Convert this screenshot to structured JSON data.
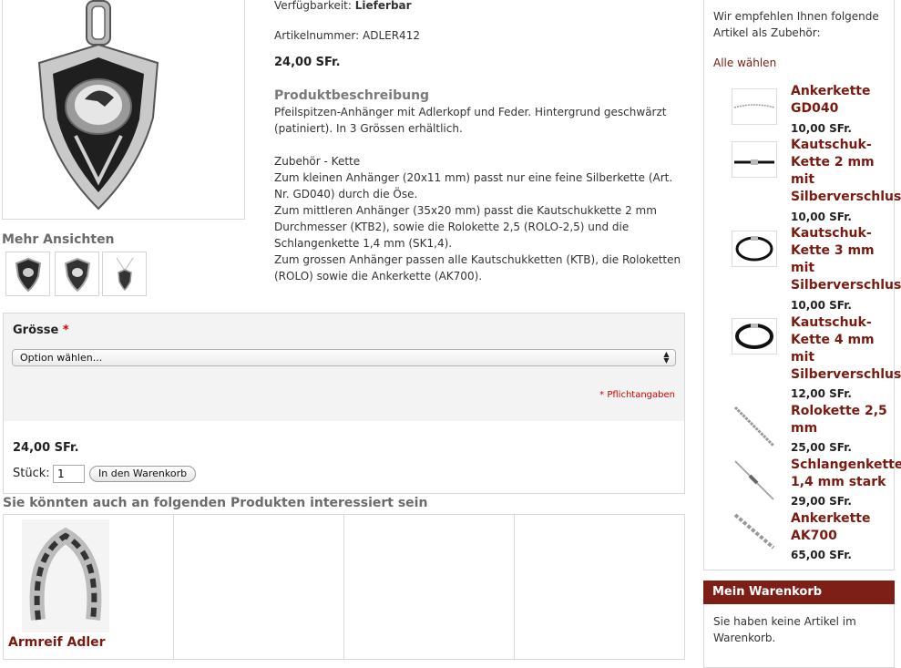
{
  "product": {
    "availability_label": "Verfügbarkeit:",
    "availability_value": "Lieferbar",
    "sku_label": "Artikelnummer:",
    "sku_value": "ADLER412",
    "price": "24,00 SFr.",
    "description_title": "Produktbeschreibung",
    "description": "Pfeilspitzen-Anhänger mit Adlerkopf und Feder. Hintergrund geschwärzt (patiniert). In 3 Grössen erhältlich.",
    "accessory_heading": "Zubehör - Kette",
    "accessory_lines": [
      "Zum kleinen Anhänger (20x11 mm) passt nur eine feine Silberkette (Art. Nr. GD040) durch die Öse.",
      "Zum mittleren Anhänger (35x20 mm) passt die Kautschukkette 2 mm Durchmesser (KTB2), sowie die Rolokette 2,5 (ROLO-2,5) und die Schlangenkette 1,4 mm (SK1,4).",
      "Zum grossen Anhänger passen alle Kautschukketten (KTB), die Roloketten (ROLO) sowie die Ankerkette (AK700)."
    ]
  },
  "gallery": {
    "more_views_title": "Mehr Ansichten"
  },
  "options": {
    "size_label": "Grösse",
    "required_mark": "*",
    "select_placeholder": "Option wählen...",
    "required_note": "* Pflichtangaben"
  },
  "cart": {
    "price": "24,00 SFr.",
    "qty_label": "Stück:",
    "qty_value": "1",
    "add_button": "In den Warenkorb"
  },
  "related": {
    "title": "Sie könnten auch an folgenden Produkten interessiert sein",
    "items": [
      {
        "name": "Armreif Adler"
      }
    ]
  },
  "sidebar": {
    "intro": "Wir empfehlen Ihnen folgende Artikel als Zubehör:",
    "select_all": "Alle wählen",
    "items": [
      {
        "name_lines": [
          "Ankerkette",
          "GD040"
        ],
        "price": "10,00 SFr.",
        "icon": "thin-chain"
      },
      {
        "name_lines": [
          "Kautschuk-",
          "Kette 2 mm",
          "mit",
          "Silberverschluss"
        ],
        "price": "10,00 SFr.",
        "icon": "rubber-cord"
      },
      {
        "name_lines": [
          "Kautschuk-",
          "Kette 3 mm",
          "mit",
          "Silberverschluss"
        ],
        "price": "10,00 SFr.",
        "icon": "rubber-loop"
      },
      {
        "name_lines": [
          "Kautschuk-",
          "Kette 4 mm",
          "mit",
          "Silberverschluss"
        ],
        "price": "12,00 SFr.",
        "icon": "rubber-loop"
      },
      {
        "name_lines": [
          "Rolokette 2,5",
          "mm"
        ],
        "price": "25,00 SFr.",
        "icon": "rolo-chain"
      },
      {
        "name_lines": [
          "Schlangenkette",
          "1,4 mm stark"
        ],
        "price": "29,00 SFr.",
        "icon": "snake-chain"
      },
      {
        "name_lines": [
          "Ankerkette",
          "AK700"
        ],
        "price": "65,00 SFr.",
        "icon": "anchor-chain"
      }
    ],
    "mini_cart_title": "Mein Warenkorb",
    "mini_cart_empty": "Sie haben keine Artikel im Warenkorb."
  },
  "colors": {
    "accent": "#7b1a10",
    "header_bar": "#7e1f17",
    "required": "#d40000"
  }
}
